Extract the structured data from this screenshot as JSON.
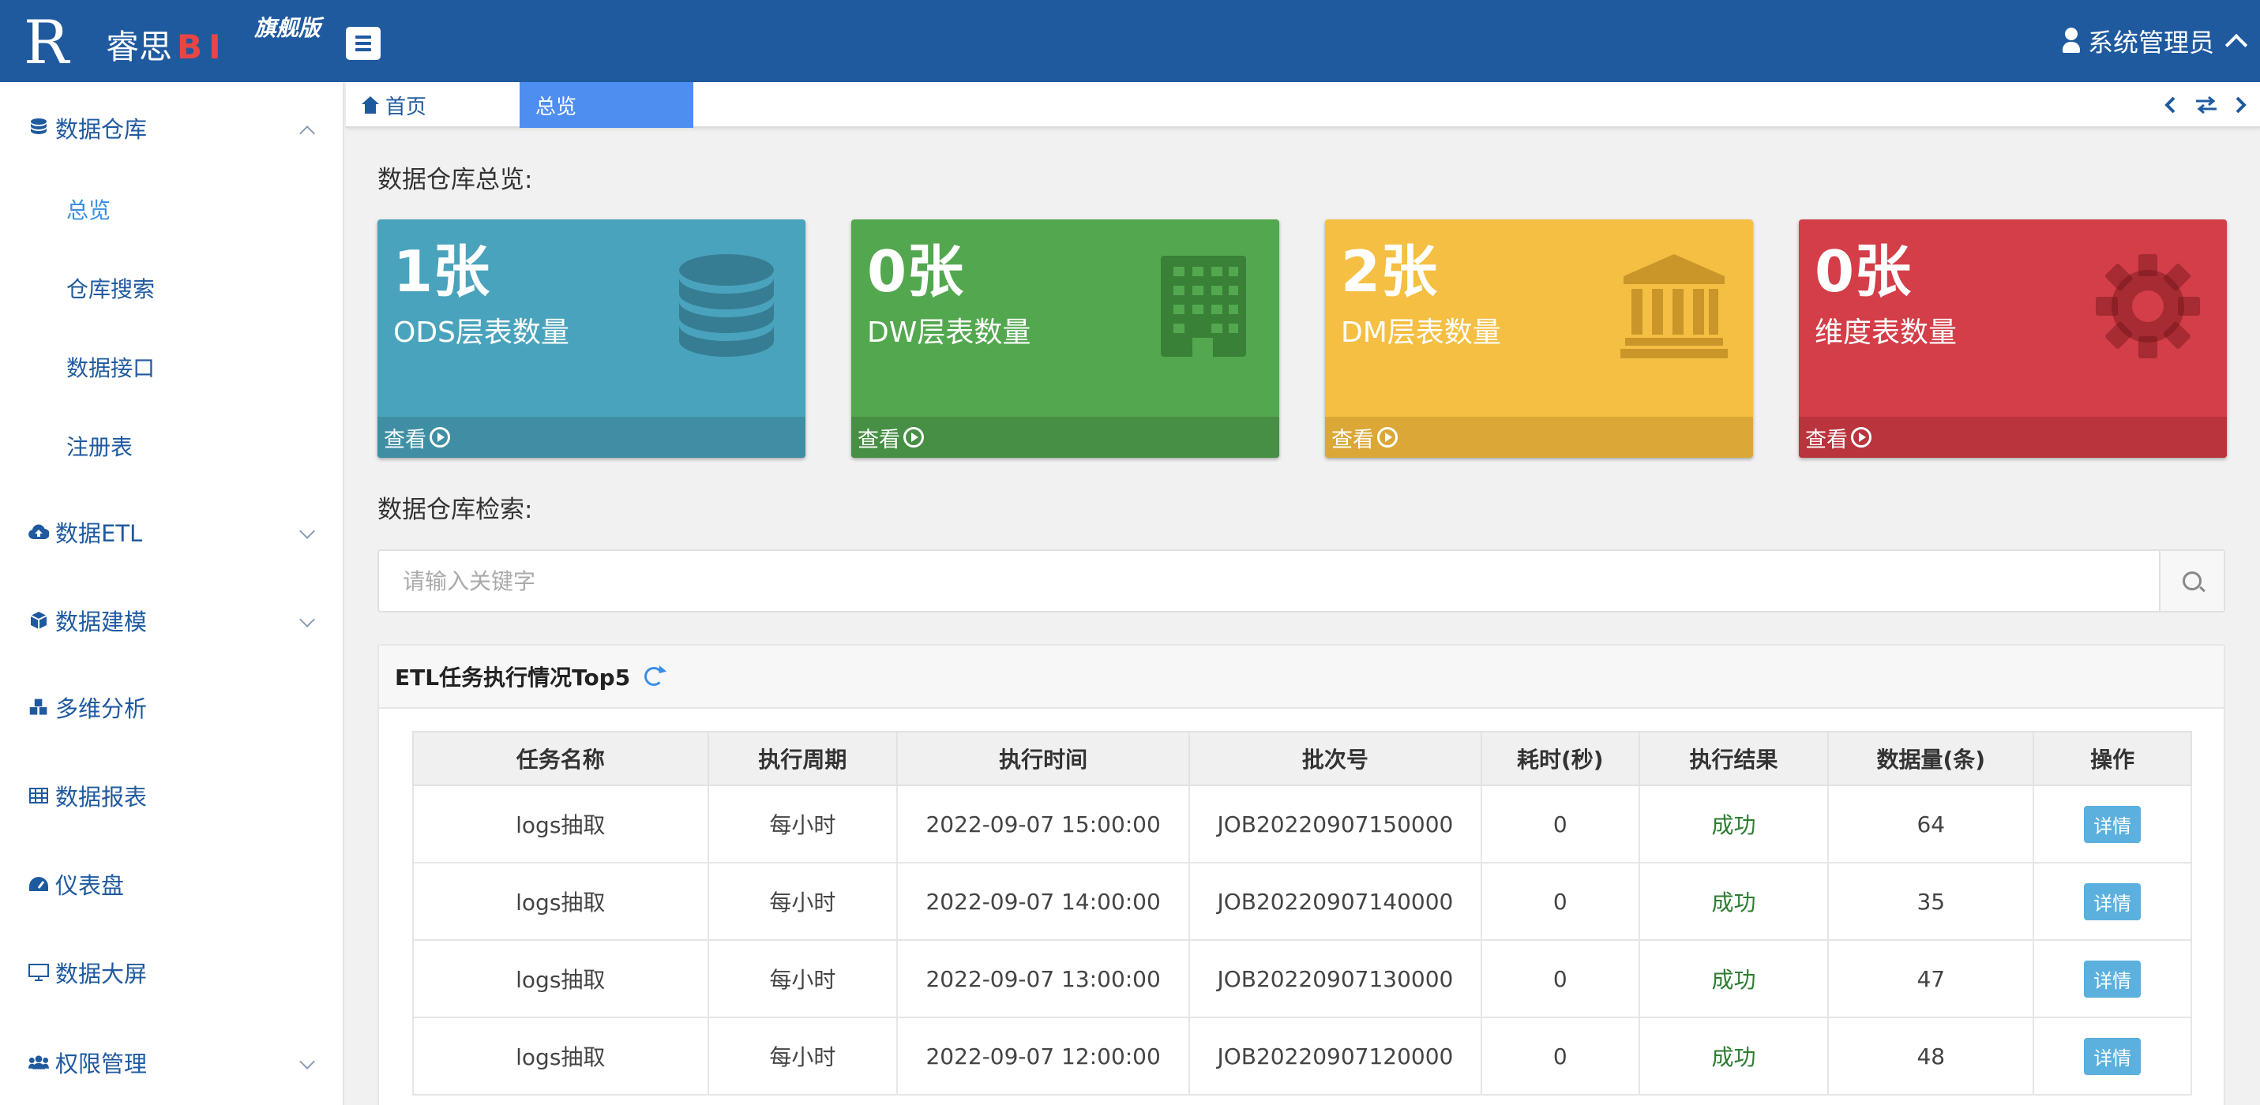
{
  "app": {
    "logo_letter": "R",
    "brand_name": "睿思",
    "brand_bi": "BI",
    "edition_badge": "旗舰版",
    "user_name": "系统管理员"
  },
  "sidebar": {
    "items": [
      {
        "label": "数据仓库",
        "icon": "database-icon",
        "expanded": true
      },
      {
        "label": "数据ETL",
        "icon": "cloud-upload-icon"
      },
      {
        "label": "数据建模",
        "icon": "cube-icon"
      },
      {
        "label": "多维分析",
        "icon": "cubes-icon"
      },
      {
        "label": "数据报表",
        "icon": "table-icon"
      },
      {
        "label": "仪表盘",
        "icon": "dashboard-icon"
      },
      {
        "label": "数据大屏",
        "icon": "monitor-icon"
      },
      {
        "label": "权限管理",
        "icon": "users-icon"
      }
    ],
    "subitems": [
      {
        "label": "总览",
        "active": true
      },
      {
        "label": "仓库搜索"
      },
      {
        "label": "数据接口"
      },
      {
        "label": "注册表"
      }
    ]
  },
  "tabs": {
    "home": "首页",
    "active": "总览"
  },
  "overview": {
    "title": "数据仓库总览:",
    "cards": [
      {
        "value": "1张",
        "label": "ODS层表数量",
        "link": "查看",
        "color": "#4aa3bc",
        "footer_color": "#3f8ea4",
        "icon": "database-icon"
      },
      {
        "value": "0张",
        "label": "DW层表数量",
        "link": "查看",
        "color": "#53a84f",
        "footer_color": "#478f44",
        "icon": "building-icon"
      },
      {
        "value": "2张",
        "label": "DM层表数量",
        "link": "查看",
        "color": "#f4bf42",
        "footer_color": "#dba838",
        "icon": "bank-icon"
      },
      {
        "value": "0张",
        "label": "维度表数量",
        "link": "查看",
        "color": "#d33e48",
        "footer_color": "#b9343d",
        "icon": "gear-icon"
      }
    ]
  },
  "search": {
    "title": "数据仓库检索:",
    "placeholder": "请输入关键字"
  },
  "etl_panel": {
    "title": "ETL任务执行情况Top5",
    "columns": [
      "任务名称",
      "执行周期",
      "执行时间",
      "批次号",
      "耗时(秒)",
      "执行结果",
      "数据量(条)",
      "操作"
    ],
    "rows": [
      [
        "logs抽取",
        "每小时",
        "2022-09-07 15:00:00",
        "JOB20220907150000",
        "0",
        "成功",
        "64",
        "详情"
      ],
      [
        "logs抽取",
        "每小时",
        "2022-09-07 14:00:00",
        "JOB20220907140000",
        "0",
        "成功",
        "35",
        "详情"
      ],
      [
        "logs抽取",
        "每小时",
        "2022-09-07 13:00:00",
        "JOB20220907130000",
        "0",
        "成功",
        "47",
        "详情"
      ],
      [
        "logs抽取",
        "每小时",
        "2022-09-07 12:00:00",
        "JOB20220907120000",
        "0",
        "成功",
        "48",
        "详情"
      ]
    ]
  }
}
